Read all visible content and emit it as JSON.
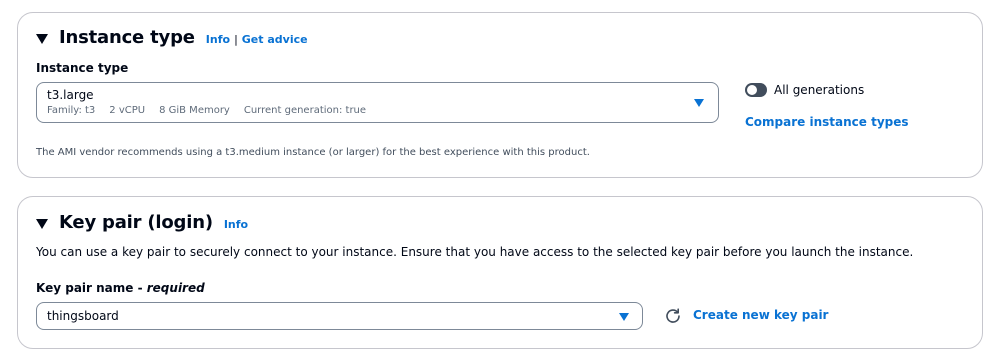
{
  "instance_type_panel": {
    "title": "Instance type",
    "info_link": "Info",
    "separator": "|",
    "advice_link": "Get advice",
    "field_label": "Instance type",
    "selected_value": "t3.large",
    "meta": {
      "family": "Family: t3",
      "vcpu": "2 vCPU",
      "memory": "8 GiB Memory",
      "generation": "Current generation: true"
    },
    "toggle_label": "All generations",
    "toggle_on": false,
    "compare_link": "Compare instance types",
    "hint": "The AMI vendor recommends using a t3.medium instance (or larger) for the best experience with this product."
  },
  "key_pair_panel": {
    "title": "Key pair (login)",
    "info_link": "Info",
    "description": "You can use a key pair to securely connect to your instance. Ensure that you have access to the selected key pair before you launch the instance.",
    "field_label": "Key pair name - ",
    "field_label_required": "required",
    "selected_value": "thingsboard",
    "create_link": "Create new key pair"
  },
  "colors": {
    "link": "#0972d3",
    "text": "#000716",
    "border": "#c6c6cd",
    "toggle_off": "#414d5c"
  },
  "icons": [
    "expand-caret-icon",
    "dropdown-arrow-icon",
    "refresh-icon"
  ]
}
